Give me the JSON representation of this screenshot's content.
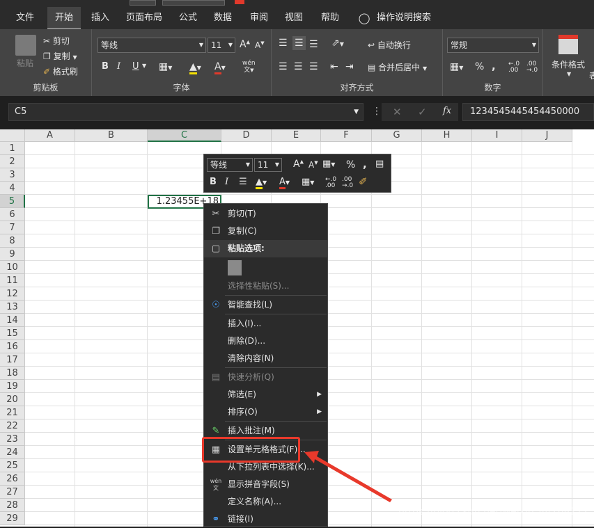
{
  "menu": {
    "tabs": [
      "文件",
      "开始",
      "插入",
      "页面布局",
      "公式",
      "数据",
      "审阅",
      "视图",
      "帮助"
    ],
    "active": "开始",
    "search": "操作说明搜索"
  },
  "ribbon": {
    "clipboard": {
      "label": "剪贴板",
      "paste": "粘贴",
      "cut": "剪切",
      "copy": "复制",
      "format_painter": "格式刷"
    },
    "font": {
      "label": "字体",
      "font_name": "等线",
      "font_size": "11",
      "bold": "B",
      "italic": "I",
      "underline": "U",
      "phonetic": "wén"
    },
    "alignment": {
      "label": "对齐方式",
      "wrap_text": "自动换行",
      "merge_center": "合并后居中"
    },
    "number": {
      "label": "数字",
      "format": "常规",
      "percent": "%",
      "comma": ","
    },
    "styles": {
      "conditional": "条件格式",
      "table": "表"
    }
  },
  "formula_bar": {
    "name_box": "C5",
    "fx": "fx",
    "value": "1234545445454450000"
  },
  "sheet": {
    "columns": [
      "A",
      "B",
      "C",
      "D",
      "E",
      "F",
      "G",
      "H",
      "I",
      "J"
    ],
    "rows": [
      "1",
      "2",
      "3",
      "4",
      "5",
      "6",
      "7",
      "8",
      "9",
      "10",
      "11",
      "12",
      "13",
      "14",
      "15",
      "16",
      "17",
      "18",
      "19",
      "20",
      "21",
      "22",
      "23",
      "24",
      "25",
      "26",
      "27",
      "28",
      "29"
    ],
    "selected_column": "C",
    "selected_row": "5",
    "c5_display": "1.23455E+18"
  },
  "mini_toolbar": {
    "font_name": "等线",
    "font_size": "11",
    "bold": "B",
    "italic": "I",
    "percent": "%",
    "comma": ","
  },
  "context_menu": {
    "cut": "剪切(T)",
    "copy": "复制(C)",
    "paste_options": "粘贴选项:",
    "paste_special": "选择性粘贴(S)...",
    "smart_lookup": "智能查找(L)",
    "insert": "插入(I)...",
    "delete": "删除(D)...",
    "clear": "清除内容(N)",
    "quick_analysis": "快速分析(Q)",
    "filter": "筛选(E)",
    "sort": "排序(O)",
    "insert_comment": "插入批注(M)",
    "format_cells": "设置单元格格式(F)...",
    "pick_list": "从下拉列表中选择(K)...",
    "phonetic": "显示拼音字段(S)",
    "define_name": "定义名称(A)...",
    "link": "链接(I)"
  },
  "watermark": "https://blog.csdn.net/weixin_44168217"
}
